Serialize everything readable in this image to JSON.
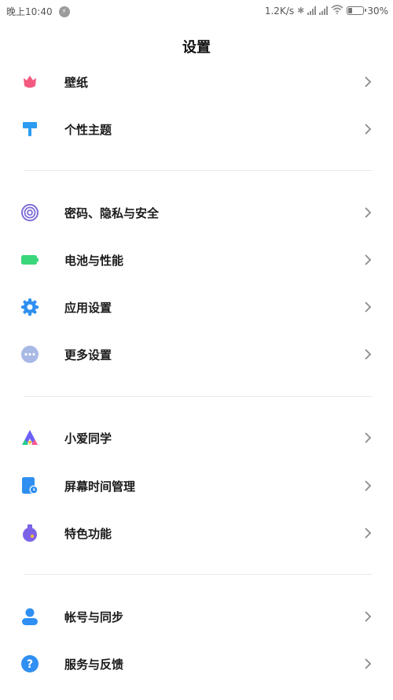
{
  "status_bar": {
    "time": "晚上10:40",
    "net_speed": "1.2K/s",
    "battery_percent_text": "30%",
    "battery_level": 0.3
  },
  "header": {
    "title": "设置"
  },
  "settings": [
    {
      "label": "壁纸",
      "icon": "tulip-icon"
    },
    {
      "label": "个性主题",
      "icon": "paint-roller-icon"
    },
    {
      "label": "密码、隐私与安全",
      "icon": "fingerprint-icon"
    },
    {
      "label": "电池与性能",
      "icon": "battery-icon"
    },
    {
      "label": "应用设置",
      "icon": "gear-icon"
    },
    {
      "label": "更多设置",
      "icon": "more-icon"
    },
    {
      "label": "小爱同学",
      "icon": "xiaoai-icon"
    },
    {
      "label": "屏幕时间管理",
      "icon": "screen-time-icon"
    },
    {
      "label": "特色功能",
      "icon": "flask-icon"
    },
    {
      "label": "帐号与同步",
      "icon": "account-icon"
    },
    {
      "label": "服务与反馈",
      "icon": "help-icon"
    }
  ],
  "colors": {
    "wallpaper": "#f45a7f",
    "theme": "#2b9cf2",
    "security": "#7e6bd8",
    "battery": "#3ad67a",
    "app_settings": "#2f8ff2",
    "more": "#a8b9e6",
    "xiaoai": "#6c60f5",
    "screen_time": "#2e8ff0",
    "feature": "#7c62e6",
    "account": "#2f8ff2",
    "help": "#2f8ff2"
  }
}
